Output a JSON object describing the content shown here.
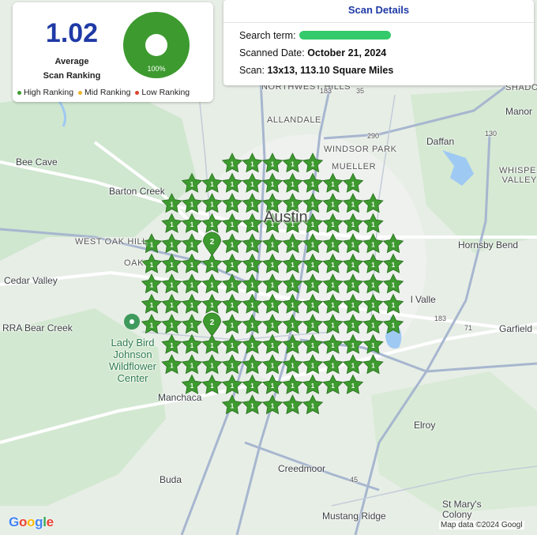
{
  "stats": {
    "average_value": "1.02",
    "average_label_line1": "Average",
    "average_label_line2": "Scan Ranking",
    "donut_percent_label": "100%",
    "high_share": 1.0,
    "legend": [
      {
        "label": "High Ranking",
        "color": "#3d9a2f"
      },
      {
        "label": "Mid Ranking",
        "color": "#f0b429"
      },
      {
        "label": "Low Ranking",
        "color": "#d9452b"
      }
    ]
  },
  "details": {
    "title": "Scan Details",
    "search_term_label": "Search term:",
    "scanned_date_label": "Scanned Date:",
    "scanned_date_value": "October 21, 2024",
    "scan_label": "Scan:",
    "scan_value": "13x13, 113.10 Square Miles"
  },
  "map": {
    "places": {
      "northwest_hills": "NORTHWEST HILLS",
      "allandale": "ALLANDALE",
      "windsor_park": "WINDSOR PARK",
      "mueller": "MUELLER",
      "daffan": "Daffan",
      "manor": "Manor",
      "shadow": "SHADO",
      "whisper_valley": "WHISPER VALLEY",
      "bee_cave": "Bee Cave",
      "barton_creek": "Barton Creek",
      "west_oak_hill": "WEST OAK HILL",
      "oak": "OAK",
      "austin": "Austin",
      "hornsby_bend": "Hornsby Bend",
      "cedar_valley": "Cedar Valley",
      "bear_creek": "RRA Bear Creek",
      "del_valle": "l Valle",
      "garfield": "Garfield",
      "lady_bird": "Lady Bird Johnson Wildflower Center",
      "manchaca": "Manchaca",
      "elroy": "Elroy",
      "creedmoor": "Creedmoor",
      "buda": "Buda",
      "mustang_ridge": "Mustang Ridge",
      "st_marys_colony": "St Mary's Colony"
    },
    "highways": [
      "183",
      "35",
      "290",
      "130",
      "71",
      "45",
      "183"
    ],
    "google_logo": "Google",
    "attribution": "Map data ©2024 Googl",
    "marker_color": "#3d9a2f",
    "grid_size": [
      13,
      13
    ],
    "marker_rankings": [
      [
        0,
        0,
        0,
        0,
        1,
        1,
        1,
        1,
        1,
        0,
        0,
        0,
        0
      ],
      [
        0,
        0,
        1,
        1,
        1,
        1,
        1,
        1,
        1,
        1,
        1,
        0,
        0
      ],
      [
        0,
        1,
        1,
        1,
        1,
        1,
        1,
        1,
        1,
        1,
        1,
        1,
        0
      ],
      [
        0,
        1,
        1,
        1,
        1,
        1,
        1,
        1,
        1,
        1,
        1,
        1,
        0
      ],
      [
        1,
        1,
        1,
        2,
        1,
        1,
        1,
        1,
        1,
        1,
        1,
        1,
        1
      ],
      [
        1,
        1,
        1,
        1,
        1,
        1,
        1,
        1,
        1,
        1,
        1,
        1,
        1
      ],
      [
        1,
        1,
        1,
        1,
        1,
        1,
        1,
        1,
        1,
        1,
        1,
        1,
        1
      ],
      [
        1,
        1,
        1,
        1,
        1,
        1,
        1,
        1,
        1,
        1,
        1,
        1,
        1
      ],
      [
        1,
        1,
        1,
        2,
        1,
        1,
        1,
        1,
        1,
        1,
        1,
        1,
        1
      ],
      [
        0,
        1,
        1,
        1,
        1,
        1,
        1,
        1,
        1,
        1,
        1,
        1,
        0
      ],
      [
        0,
        1,
        1,
        1,
        1,
        1,
        1,
        1,
        1,
        1,
        1,
        1,
        0
      ],
      [
        0,
        0,
        1,
        1,
        1,
        1,
        1,
        1,
        1,
        1,
        1,
        0,
        0
      ],
      [
        0,
        0,
        0,
        0,
        1,
        1,
        1,
        1,
        1,
        0,
        0,
        0,
        0
      ]
    ]
  }
}
